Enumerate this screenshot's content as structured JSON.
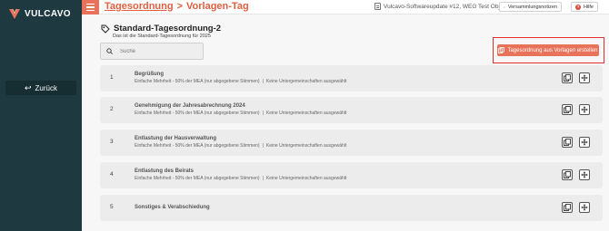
{
  "sidebar": {
    "brand": "VULCAVO",
    "back_label": "Zurück"
  },
  "topbar": {
    "breadcrumb_parent": "Tagesordnung",
    "breadcrumb_separator": ">",
    "breadcrumb_current": "Vorlagen-Tag",
    "update_text": "Vulcavo-Softwareupdate #12, WEG Test Objekt",
    "notes_label": "Versammlungsnotizen",
    "help_label": "Hilfe"
  },
  "page": {
    "title": "Standard-Tagesordnung-2",
    "subtitle": "Das ist die Standard-Tagesordnung für 2025",
    "search_placeholder": "Suche",
    "create_label": "Tagesordnung aus Vorlagen erstellen"
  },
  "items": [
    {
      "number": "1",
      "name": "Begrüßung",
      "majority": "Einfache Mehrheit - 50% der MEA (nur abgegebene Stimmen)",
      "separator": "|",
      "scope": "Keine Untergemeinschaften ausgewählt"
    },
    {
      "number": "2",
      "name": "Genehmigung der Jahresabrechnung 2024",
      "majority": "Einfache Mehrheit - 50% der MEA (nur abgegebene Stimmen)",
      "separator": "|",
      "scope": "Keine Untergemeinschaften ausgewählt"
    },
    {
      "number": "3",
      "name": "Entlastung der Hausverwaltung",
      "majority": "Einfache Mehrheit - 50% der MEA (nur abgegebene Stimmen)",
      "separator": "|",
      "scope": "Keine Untergemeinschaften ausgewählt"
    },
    {
      "number": "4",
      "name": "Entlastung des Beirats",
      "majority": "Einfache Mehrheit - 50% der MEA (nur abgegebene Stimmen)",
      "separator": "|",
      "scope": "Keine Untergemeinschaften ausgewählt"
    },
    {
      "number": "5",
      "name": "Sonstiges & Verabschiedung"
    }
  ],
  "colors": {
    "accent": "#e8735a",
    "sidebar": "#1e3a40",
    "highlight": "#e03030"
  },
  "icons": {
    "menu": "hamburger-icon",
    "tag": "tag-icon",
    "search": "search-icon",
    "copy": "copy-icon",
    "move": "move-icon",
    "help": "help-icon"
  }
}
